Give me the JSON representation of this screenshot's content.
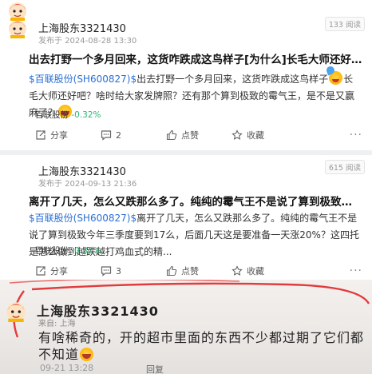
{
  "posts": [
    {
      "username": "上海股东3321430",
      "published": "发布于 2024-08-28 13:30",
      "views": "133 阅读",
      "title": "出去打野一个多月回来，这货咋跌成这鸟样子[为什么]长毛大师还好吧？啥时给...",
      "body": {
        "stock": "$百联股份(SH600827)$",
        "text_a": "出去打野一个多月回来，这货咋跌成这鸟样子",
        "text_b": "长毛大师还好吧？啥时给大家发牌照？还有那个算到极致的霉气王，是不是又赢麻了？"
      },
      "tag": {
        "name": "百联股份",
        "change": "-0.32%"
      },
      "actions": {
        "share": "分享",
        "comments": "2",
        "like": "点赞",
        "favorite": "收藏"
      }
    },
    {
      "username": "上海股东3321430",
      "published": "发布于 2024-09-13 21:36",
      "views": "615 阅读",
      "title": "离开了几天，怎么又跌那么多了。纯纯的霉气王不是说了算到极致今年三季度要...",
      "body": {
        "stock": "$百联股份(SH600827)$",
        "text_a": "离开了几天，怎么又跌那么多了。纯纯的霉气王不是说了算到极致今年三季度要到17么，后面几天这是要准备一天涨20%？这四托是怎么做到越跌越打鸡血式的精..."
      },
      "tag": {
        "name": "百联股份",
        "change": "-0.32%"
      },
      "actions": {
        "share": "分享",
        "comments": "3",
        "like": "点赞",
        "favorite": "收藏"
      }
    }
  ],
  "photo": {
    "username": "上海股东3321430",
    "from": "来自: 上海",
    "text": "有啥稀奇的，开的超市里面的东西不少都过期了它们都不知道",
    "time": "09-21 13:28",
    "reply": "回复"
  },
  "colors": {
    "accent": "#2a6fd6",
    "down": "#2bb673",
    "annotation": "#e23b3b"
  },
  "icons": [
    "avatar-cartoon-icon",
    "share-icon",
    "comment-icon",
    "like-icon",
    "favorite-icon",
    "more-icon",
    "crazy-emoji-icon",
    "laugh-emoji-icon",
    "smile-emoji-icon"
  ]
}
